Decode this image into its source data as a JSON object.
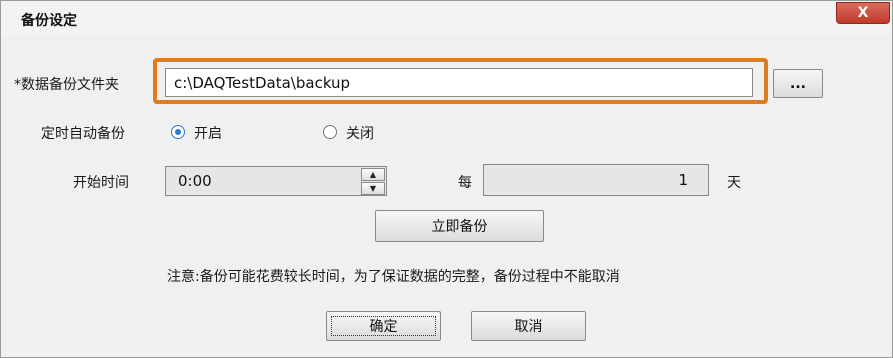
{
  "window": {
    "title": "备份设定",
    "close_label": "X"
  },
  "backup_folder": {
    "label": "*数据备份文件夹",
    "value": "c:\\DAQTestData\\backup",
    "browse_label": "..."
  },
  "auto_backup": {
    "label": "定时自动备份",
    "options": [
      {
        "label": "开启",
        "selected": true
      },
      {
        "label": "关闭",
        "selected": false
      }
    ]
  },
  "start_time": {
    "label": "开始时间",
    "value": "0:00"
  },
  "interval": {
    "prefix": "每",
    "value": "1",
    "unit": "天"
  },
  "buttons": {
    "backup_now": "立即备份",
    "ok": "确定",
    "cancel": "取消"
  },
  "note": "注意:备份可能花费较长时间，为了保证数据的完整，备份过程中不能取消",
  "colors": {
    "highlight": "#e07b20",
    "radio_accent": "#2a7ad5",
    "close": "#c0392b"
  }
}
